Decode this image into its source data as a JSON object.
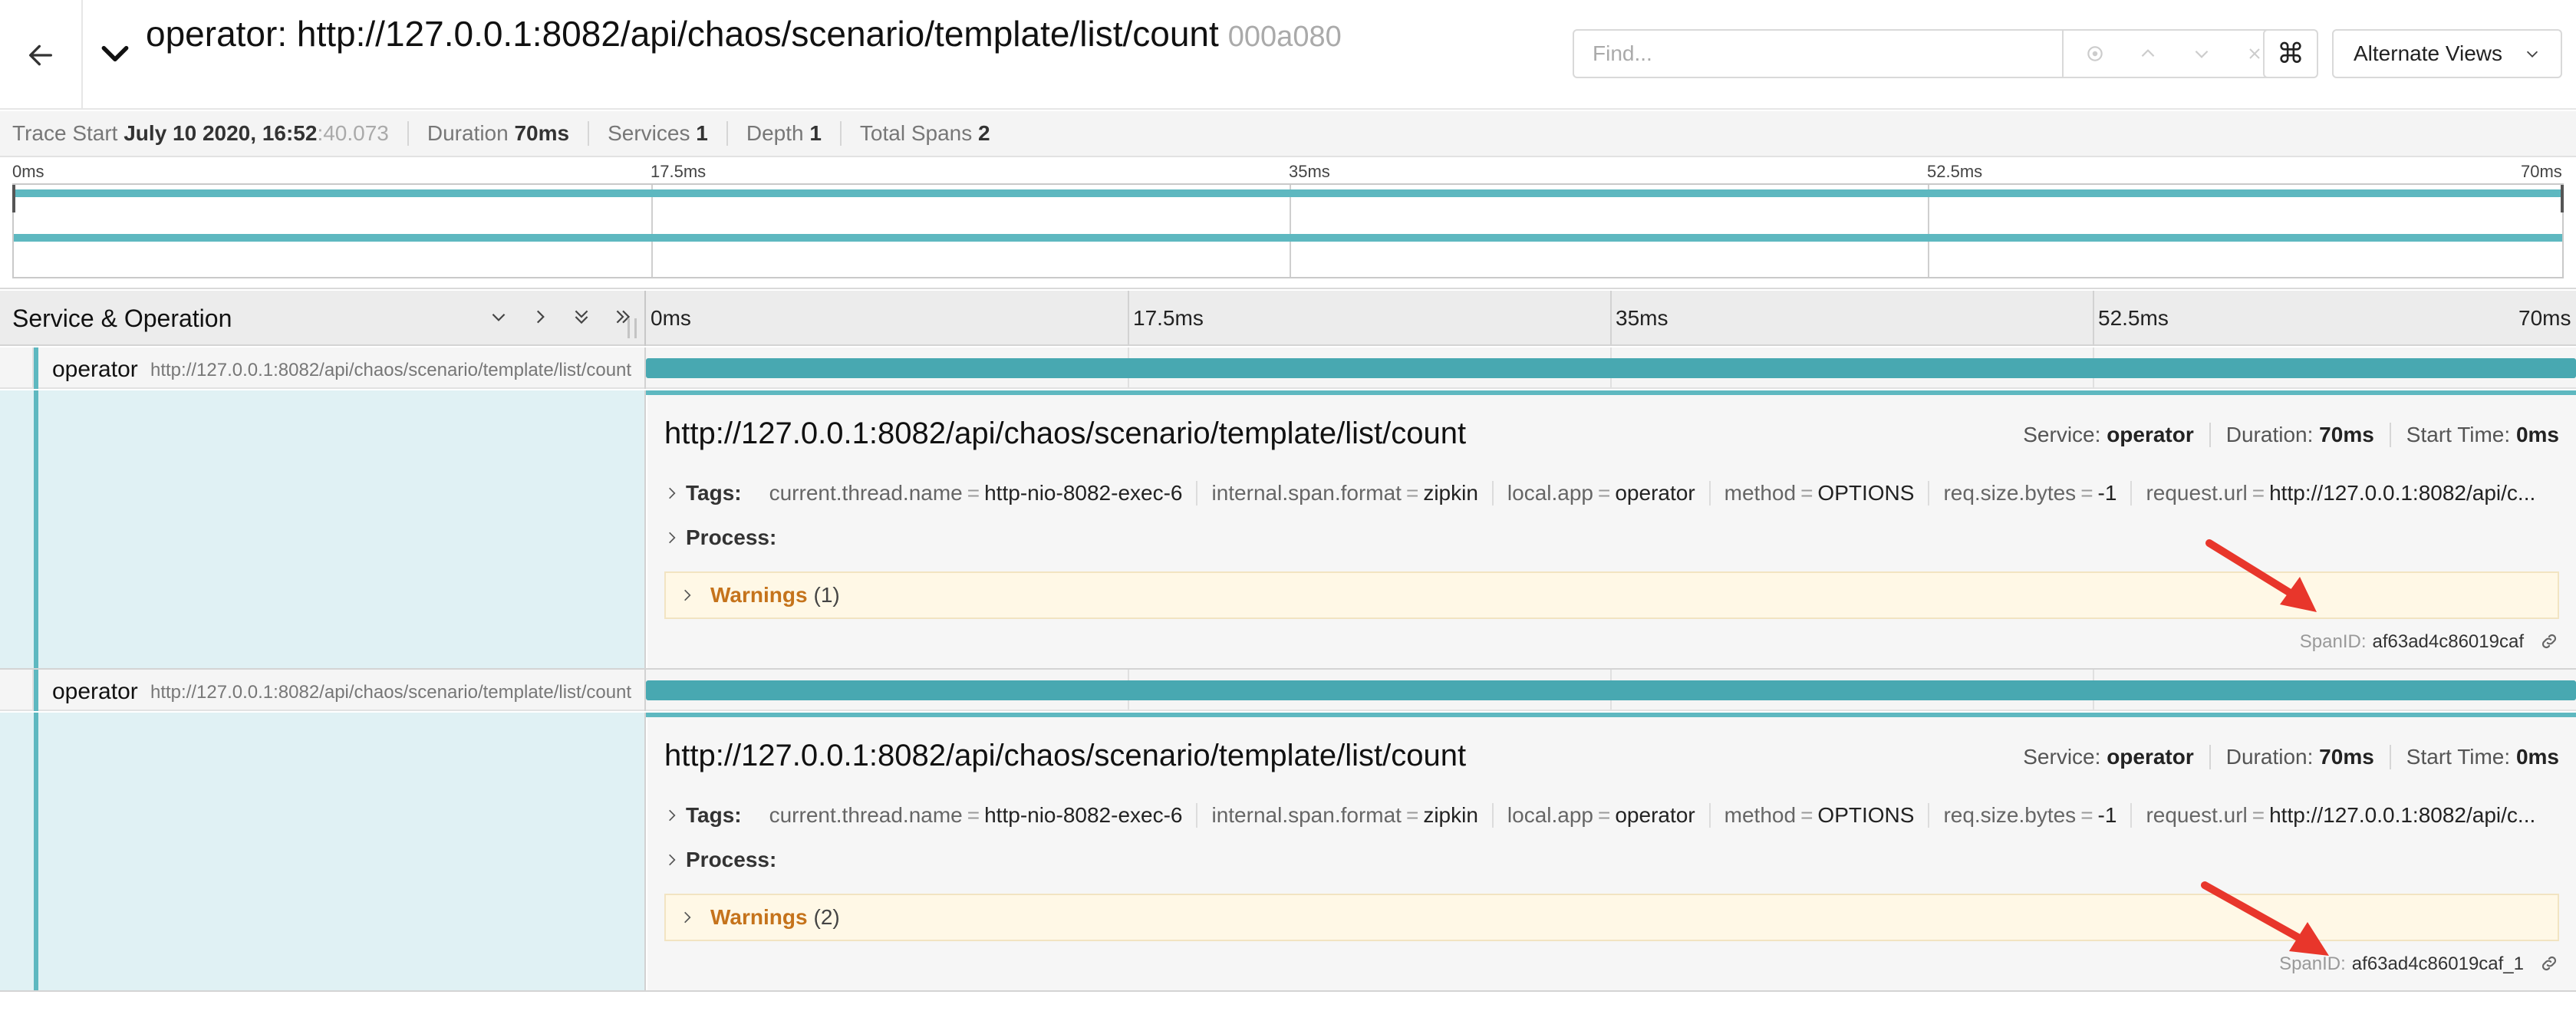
{
  "header": {
    "title": "operator: http://127.0.0.1:8082/api/chaos/scenario/template/list/count",
    "trace_id": "000a080",
    "find_placeholder": "Find...",
    "kbd_symbol": "⌘",
    "alternate_views": "Alternate Views"
  },
  "summary": {
    "trace_start_label": "Trace Start",
    "trace_start_value": "July 10 2020, 16:52",
    "trace_start_ms": ":40.073",
    "duration_label": "Duration",
    "duration_value": "70ms",
    "services_label": "Services",
    "services_value": "1",
    "depth_label": "Depth",
    "depth_value": "1",
    "total_spans_label": "Total Spans",
    "total_spans_value": "2"
  },
  "minimap": {
    "ticks": [
      "0ms",
      "17.5ms",
      "35ms",
      "52.5ms",
      "70ms"
    ]
  },
  "timeline": {
    "title": "Service & Operation",
    "ticks": [
      "0ms",
      "17.5ms",
      "35ms",
      "52.5ms",
      "70ms"
    ]
  },
  "spans": [
    {
      "service": "operator",
      "operation": "http://127.0.0.1:8082/api/chaos/scenario/template/list/count",
      "detail_title": "http://127.0.0.1:8082/api/chaos/scenario/template/list/count",
      "service_label": "Service:",
      "service_value": "operator",
      "duration_label": "Duration:",
      "duration_value": "70ms",
      "start_label": "Start Time:",
      "start_value": "0ms",
      "tags_label": "Tags:",
      "tags": [
        {
          "k": "current.thread.name",
          "v": "http-nio-8082-exec-6"
        },
        {
          "k": "internal.span.format",
          "v": "zipkin"
        },
        {
          "k": "local.app",
          "v": "operator"
        },
        {
          "k": "method",
          "v": "OPTIONS"
        },
        {
          "k": "req.size.bytes",
          "v": "-1"
        },
        {
          "k": "request.url",
          "v": "http://127.0.0.1:8082/api/c..."
        }
      ],
      "process_label": "Process:",
      "warnings_label": "Warnings",
      "warnings_count": "(1)",
      "spanid_label": "SpanID:",
      "spanid_value": "af63ad4c86019caf"
    },
    {
      "service": "operator",
      "operation": "http://127.0.0.1:8082/api/chaos/scenario/template/list/count",
      "detail_title": "http://127.0.0.1:8082/api/chaos/scenario/template/list/count",
      "service_label": "Service:",
      "service_value": "operator",
      "duration_label": "Duration:",
      "duration_value": "70ms",
      "start_label": "Start Time:",
      "start_value": "0ms",
      "tags_label": "Tags:",
      "tags": [
        {
          "k": "current.thread.name",
          "v": "http-nio-8082-exec-6"
        },
        {
          "k": "internal.span.format",
          "v": "zipkin"
        },
        {
          "k": "local.app",
          "v": "operator"
        },
        {
          "k": "method",
          "v": "OPTIONS"
        },
        {
          "k": "req.size.bytes",
          "v": "-1"
        },
        {
          "k": "request.url",
          "v": "http://127.0.0.1:8082/api/c..."
        }
      ],
      "process_label": "Process:",
      "warnings_label": "Warnings",
      "warnings_count": "(2)",
      "spanid_label": "SpanID:",
      "spanid_value": "af63ad4c86019caf_1"
    }
  ],
  "colors": {
    "service_teal": "#48a8b1",
    "warning_text": "#c5731b",
    "annotation_arrow": "#e8362b"
  }
}
